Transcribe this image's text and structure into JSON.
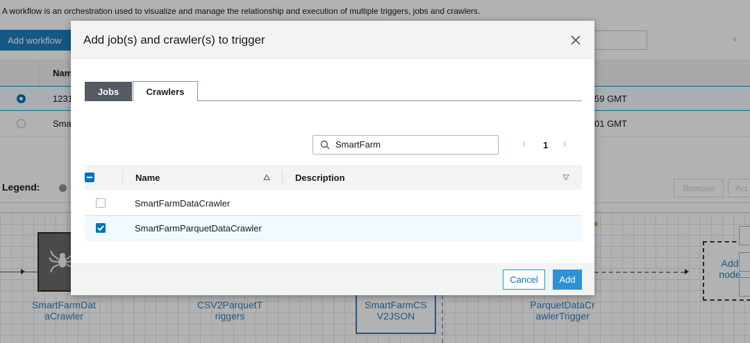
{
  "background": {
    "description": "A workflow is an orchestration used to visualize and manage the relationship and execution of multiple triggers, jobs and crawlers.",
    "add_workflow_label": "Add workflow",
    "table_header_name": "Nam",
    "rows": [
      {
        "name": "1231",
        "time": "59 GMT",
        "selected": true
      },
      {
        "name": "Sma",
        "time": "01 GMT",
        "selected": false
      }
    ],
    "legend_label": "Legend:",
    "remove_label": "Remove",
    "act_label": "Act",
    "graph_nodes": [
      {
        "label": "SmartFarmDat aCrawler"
      },
      {
        "label": "CSV2ParquetT riggers"
      },
      {
        "label": "SmartFarmCS V2JSON"
      },
      {
        "label": "ParquetDataCr awlerTrigger"
      }
    ],
    "add_node_label": "Add node"
  },
  "modal": {
    "title": "Add job(s) and crawler(s) to trigger",
    "tabs": [
      {
        "label": "Jobs",
        "active": false
      },
      {
        "label": "Crawlers",
        "active": true
      }
    ],
    "search": {
      "value": "SmartFarm",
      "icon": "search-icon"
    },
    "pagination": {
      "page": "1"
    },
    "table": {
      "columns": [
        {
          "label": "Name",
          "sort": "ascending"
        },
        {
          "label": "Description",
          "sort": "descending"
        }
      ],
      "rows": [
        {
          "name": "SmartFarmDataCrawler",
          "description": "",
          "checked": false
        },
        {
          "name": "SmartFarmParquetDataCrawler",
          "description": "",
          "checked": true
        }
      ]
    },
    "buttons": {
      "cancel": "Cancel",
      "add": "Add"
    }
  },
  "colors": {
    "accent": "#0073bb",
    "primary_button": "#2e91d6",
    "active_tab": "#545b64",
    "selected_row": "#f1faff"
  }
}
